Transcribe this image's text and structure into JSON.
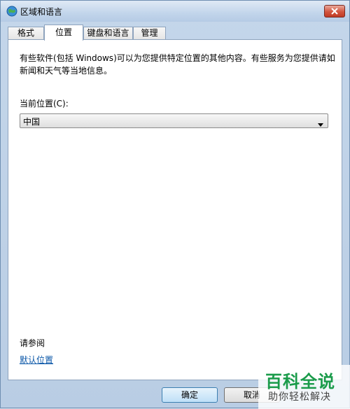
{
  "window": {
    "title": "区域和语言",
    "icon": "globe-icon",
    "close_icon": "close-icon"
  },
  "tabs": [
    {
      "label": "格式"
    },
    {
      "label": "位置",
      "active": true
    },
    {
      "label": "键盘和语言"
    },
    {
      "label": "管理"
    }
  ],
  "location": {
    "description": "有些软件(包括 Windows)可以为您提供特定位置的其他内容。有些服务为您提供请如新闻和天气等当地信息。",
    "current_label": "当前位置(C):",
    "current_value": "中国",
    "see_also_label": "请参阅",
    "default_location_link": "默认位置"
  },
  "buttons": {
    "ok": "确定",
    "cancel": "取消"
  },
  "watermark": {
    "title": "百科全说",
    "subtitle": "助你轻松解决"
  },
  "colors": {
    "link": "#0b57a8",
    "watermark_green": "#1a9b4a",
    "close_red": "#c03b24"
  }
}
